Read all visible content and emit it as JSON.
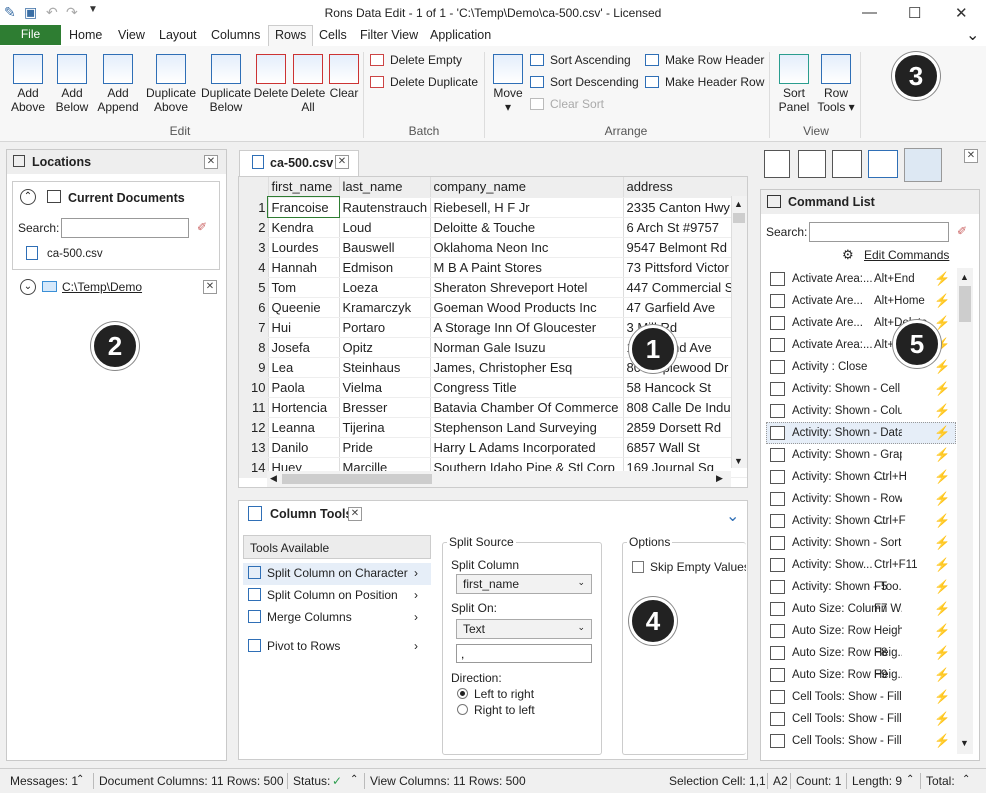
{
  "window": {
    "title": "Rons Data Edit - 1 of 1 - 'C:\\Temp\\Demo\\ca-500.csv' - Licensed",
    "min": "—",
    "max": "☐",
    "close": "✕"
  },
  "menu": {
    "file": "File",
    "tabs": [
      "Home",
      "View",
      "Layout",
      "Columns",
      "Rows",
      "Cells",
      "Filter View",
      "Application"
    ],
    "collapse": "⌄"
  },
  "ribbon": {
    "edit_buttons": [
      {
        "l1": "Add",
        "l2": "Above"
      },
      {
        "l1": "Add",
        "l2": "Below"
      },
      {
        "l1": "Add",
        "l2": "Append"
      },
      {
        "l1": "Duplicate",
        "l2": "Above"
      },
      {
        "l1": "Duplicate",
        "l2": "Below"
      },
      {
        "l1": "Delete",
        "l2": ""
      },
      {
        "l1": "Delete",
        "l2": "All"
      },
      {
        "l1": "Clear",
        "l2": ""
      }
    ],
    "edit_group": "Edit",
    "delete_empty": "Delete Empty",
    "delete_duplicate": "Delete Duplicate",
    "batch_group": "Batch",
    "move": "Move",
    "sort_asc": "Sort Ascending",
    "sort_desc": "Sort Descending",
    "clear_sort": "Clear Sort",
    "make_row_header": "Make Row Header",
    "make_header_row": "Make Header Row",
    "arrange_group": "Arrange",
    "sort_panel": {
      "l1": "Sort",
      "l2": "Panel"
    },
    "row_tools": {
      "l1": "Row",
      "l2": "Tools ▾"
    },
    "view_group": "View"
  },
  "callouts": [
    "1",
    "2",
    "3",
    "4",
    "5"
  ],
  "locations": {
    "title": "Locations",
    "current_documents": "Current Documents",
    "search_label": "Search:",
    "search_value": "",
    "doc": "ca-500.csv",
    "folder": "C:\\Temp\\Demo"
  },
  "document": {
    "tab": "ca-500.csv",
    "columns": [
      "first_name",
      "last_name",
      "company_name",
      "address"
    ],
    "rows": [
      [
        "1",
        "Francoise",
        "Rautenstrauch",
        "Riebesell, H F Jr",
        "2335 Canton Hwy"
      ],
      [
        "2",
        "Kendra",
        "Loud",
        "Deloitte & Touche",
        "6 Arch St #9757"
      ],
      [
        "3",
        "Lourdes",
        "Bauswell",
        "Oklahoma Neon Inc",
        "9547 Belmont Rd"
      ],
      [
        "4",
        "Hannah",
        "Edmison",
        "M B A Paint Stores",
        "73 Pittsford Victor"
      ],
      [
        "5",
        "Tom",
        "Loeza",
        "Sheraton Shreveport Hotel",
        "447 Commercial S"
      ],
      [
        "6",
        "Queenie",
        "Kramarczyk",
        "Goeman Wood Products Inc",
        "47 Garfield Ave"
      ],
      [
        "7",
        "Hui",
        "Portaro",
        "A Storage Inn Of Gloucester",
        "3 Mill Rd"
      ],
      [
        "8",
        "Josefa",
        "Opitz",
        "Norman Gale Isuzu",
        "136 Brand Ave"
      ],
      [
        "9",
        "Lea",
        "Steinhaus",
        "James, Christopher Esq",
        "80 Maplewood Dr"
      ],
      [
        "10",
        "Paola",
        "Vielma",
        "Congress Title",
        "58 Hancock St"
      ],
      [
        "11",
        "Hortencia",
        "Bresser",
        "Batavia Chamber Of Commerce",
        "808 Calle De Indu"
      ],
      [
        "12",
        "Leanna",
        "Tijerina",
        "Stephenson Land Surveying",
        "2859 Dorsett Rd"
      ],
      [
        "13",
        "Danilo",
        "Pride",
        "Harry L Adams Incorporated",
        "6857 Wall St"
      ],
      [
        "14",
        "Huey",
        "Marcille",
        "Southern Idaho Pipe & Stl Corp",
        "169 Journal Sq"
      ]
    ]
  },
  "column_tools": {
    "title": "Column Tools",
    "tools_available": "Tools Available",
    "tools": [
      "Split Column on Character",
      "Split Column on Position",
      "Merge Columns",
      "Pivot to Rows"
    ],
    "split_source": "Split Source",
    "split_column": "Split Column",
    "split_column_value": "first_name",
    "split_on": "Split On:",
    "split_on_value": "Text",
    "split_text": ",",
    "direction": "Direction:",
    "ltr": "Left to right",
    "rtl": "Right to left",
    "options": "Options",
    "skip_empty": "Skip Empty Values"
  },
  "command_list": {
    "title": "Command List",
    "search_label": "Search:",
    "search_value": "",
    "edit_commands": "Edit Commands",
    "items": [
      {
        "label": "Activate Area:...",
        "key": "Alt+End"
      },
      {
        "label": "Activate Are...",
        "key": "Alt+Home"
      },
      {
        "label": "Activate Are...",
        "key": "Alt+Delete"
      },
      {
        "label": "Activate Area:...",
        "key": "Alt+..."
      },
      {
        "label": "Activity : Close",
        "key": ""
      },
      {
        "label": "Activity: Shown - Cell T...",
        "key": ""
      },
      {
        "label": "Activity: Shown - Colum...",
        "key": ""
      },
      {
        "label": "Activity: Shown - Data...",
        "key": ""
      },
      {
        "label": "Activity: Shown - Graph",
        "key": ""
      },
      {
        "label": "Activity: Shown -...",
        "key": "Ctrl+H"
      },
      {
        "label": "Activity: Shown - Row T...",
        "key": ""
      },
      {
        "label": "Activity: Shown -...",
        "key": "Ctrl+F"
      },
      {
        "label": "Activity: Shown - Sort",
        "key": ""
      },
      {
        "label": "Activity: Show...",
        "key": "Ctrl+F11"
      },
      {
        "label": "Activity: Shown - Too...",
        "key": "F5"
      },
      {
        "label": "Auto Size: Column W...",
        "key": "F7"
      },
      {
        "label": "Auto Size: Row Height...",
        "key": ""
      },
      {
        "label": "Auto Size: Row Heig...",
        "key": "F8"
      },
      {
        "label": "Auto Size: Row Heig...",
        "key": "F9"
      },
      {
        "label": "Cell Tools: Show - Fill C...",
        "key": ""
      },
      {
        "label": "Cell Tools: Show - Fill E...",
        "key": ""
      },
      {
        "label": "Cell Tools: Show - Fill L...",
        "key": ""
      }
    ]
  },
  "status": {
    "messages": "Messages: 1",
    "doc_cols": "Document Columns: 11 Rows: 500",
    "status": "Status:",
    "view_cols": "View Columns: 11 Rows: 500",
    "selection": "Selection Cell: 1,1",
    "a2": "A2",
    "count": "Count: 1",
    "length": "Length: 9",
    "total": "Total:"
  },
  "colors": {
    "file_tab": "#2e7d32",
    "accent": "#2f6fb6",
    "bolt": "#f0a800"
  }
}
